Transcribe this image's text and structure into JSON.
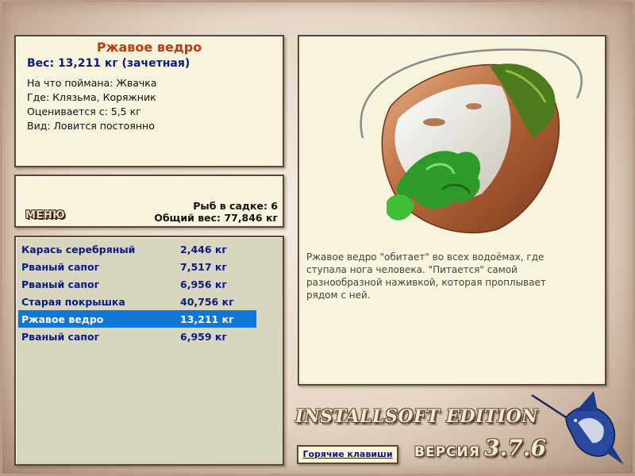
{
  "fish_info": {
    "title": "Ржавое ведро",
    "weight": "Вес: 13,211 кг (зачетная)",
    "caught_on": "На что поймана: Жвачка",
    "location": "Где: Клязьма, Коряжник",
    "valued_from": "Оценивается с: 5,5 кг",
    "kind": "Вид: Ловится постоянно"
  },
  "stats": {
    "menu_label": "МЕНЮ",
    "fish_in_net": "Рыб в садке: 6",
    "total_weight": "Общий вес: 77,846 кг"
  },
  "catch_list": [
    {
      "name": "Карась серебряный",
      "weight": "2,446 кг",
      "selected": false
    },
    {
      "name": "Рваный сапог",
      "weight": "7,517 кг",
      "selected": false
    },
    {
      "name": "Рваный сапог",
      "weight": "6,956 кг",
      "selected": false
    },
    {
      "name": "Старая покрышка",
      "weight": "40,756 кг",
      "selected": false
    },
    {
      "name": "Ржавое ведро",
      "weight": "13,211 кг",
      "selected": true
    },
    {
      "name": "Рваный сапог",
      "weight": "6,959 кг",
      "selected": false
    }
  ],
  "picture": {
    "image": "rusty-bucket-with-seaweed",
    "description": "Ржавое ведро \"обитает\" во всех водоёмах, где ступала нога человека. \"Питается\" самой разнообразной наживкой, которая проплывает рядом с ней."
  },
  "footer": {
    "edition": "INSTALLSOFT EDITION",
    "hotkeys": "Горячие клавиши",
    "version_label": "ВЕРСИЯ",
    "version": "3.7.6",
    "logo": "marlin-icon"
  },
  "colors": {
    "title": "#c0390f",
    "accent_blue": "#0a1a86",
    "selection": "#1077d6",
    "panel_bg": "#f7f3dc",
    "list_bg": "#d8d6bc",
    "border": "#5b4634"
  }
}
